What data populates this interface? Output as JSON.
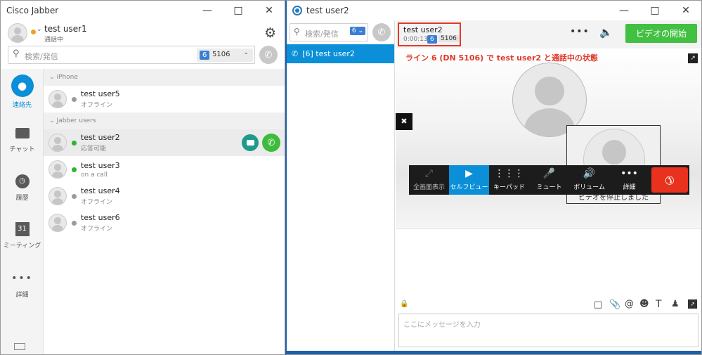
{
  "left_window": {
    "title": "Cisco Jabber",
    "profile": {
      "name": "test user1",
      "status": "通話中"
    },
    "search": {
      "placeholder": "検索/発信",
      "line_number": "6",
      "dn": "5106"
    },
    "nav": [
      {
        "label": "連絡先"
      },
      {
        "label": "チャット"
      },
      {
        "label": "履歴"
      },
      {
        "label": "ミーティング",
        "day": "31"
      },
      {
        "label": "詳細"
      }
    ],
    "groups": [
      {
        "name": "iPhone",
        "contacts": [
          {
            "name": "test user5",
            "status": "オフライン",
            "dot": "#9a9a9a"
          }
        ]
      },
      {
        "name": "Jabber users",
        "contacts": [
          {
            "name": "test user2",
            "status": "応答可能",
            "dot": "#2db52d"
          },
          {
            "name": "test user3",
            "status": "on a call",
            "dot": "#2db52d"
          },
          {
            "name": "test user4",
            "status": "オフライン",
            "dot": "#9a9a9a"
          },
          {
            "name": "test user6",
            "status": "オフライン",
            "dot": "#9a9a9a"
          }
        ]
      }
    ]
  },
  "right_window": {
    "title": "test user2",
    "search": {
      "placeholder": "検索/発信",
      "line_number": "6"
    },
    "conversation_item": "[6] test user2",
    "call_info": {
      "name": "test user2",
      "timer": "0:00:13",
      "line_number": "6",
      "dn": "5106"
    },
    "video_button": "ビデオの開始",
    "annotation": "ライン 6 (DN 5106) で test user2 と通話中の状態",
    "self_view_text": "ビデオを停止しました",
    "toolbar": [
      {
        "label": "全画面表示",
        "icon": "fullscreen-icon"
      },
      {
        "label": "セルフビュー",
        "icon": "self-view-icon"
      },
      {
        "label": "キーパッド",
        "icon": "keypad-icon"
      },
      {
        "label": "ミュート",
        "icon": "mute-icon"
      },
      {
        "label": "ボリューム",
        "icon": "volume-icon"
      },
      {
        "label": "詳細",
        "icon": "more-icon"
      }
    ],
    "message_placeholder": "ここにメッセージを入力"
  },
  "colors": {
    "accent_blue": "#0a8fd8",
    "online_green": "#2db52d",
    "call_green": "#3dbb3d",
    "hangup_red": "#e8321e",
    "annotation_red": "#e03a2a",
    "video_btn_green": "#42c042"
  }
}
